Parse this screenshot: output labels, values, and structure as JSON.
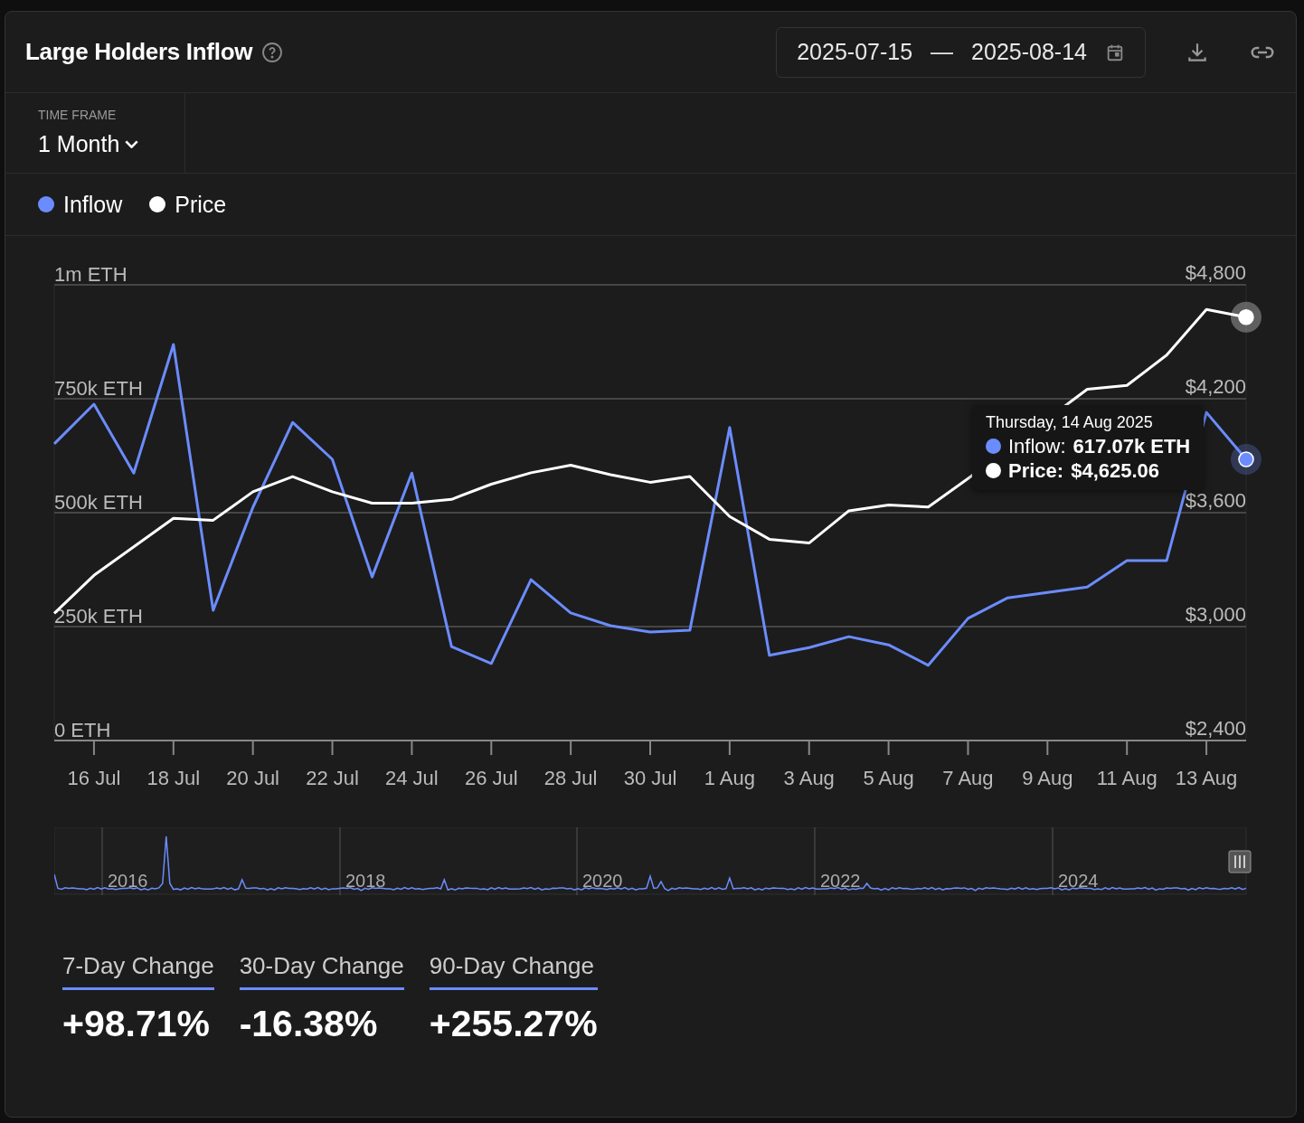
{
  "header": {
    "title": "Large Holders Inflow",
    "date_from": "2025-07-15",
    "date_separator": "—",
    "date_to": "2025-08-14"
  },
  "time_frame": {
    "label": "TIME FRAME",
    "value": "1 Month"
  },
  "chart": {
    "chart_data": {
      "type": "line",
      "categories": [
        null,
        "16 Jul",
        null,
        "18 Jul",
        null,
        "20 Jul",
        null,
        "22 Jul",
        null,
        "24 Jul",
        null,
        "26 Jul",
        null,
        "28 Jul",
        null,
        "30 Jul",
        null,
        "1 Aug",
        null,
        "3 Aug",
        null,
        "5 Aug",
        null,
        "7 Aug",
        null,
        "9 Aug",
        null,
        "11 Aug",
        null,
        "13 Aug",
        null
      ],
      "series": [
        {
          "name": "Inflow",
          "color": "#6b8cff",
          "values": [
            651000,
            738000,
            587000,
            869000,
            286000,
            512000,
            698000,
            617000,
            359000,
            587000,
            206000,
            169000,
            353000,
            280000,
            252000,
            238000,
            242000,
            687000,
            187000,
            204000,
            228000,
            210000,
            165000,
            268000,
            313000,
            null,
            337000,
            395000,
            395000,
            720000,
            617000
          ]
        },
        {
          "name": "Price",
          "color": "#ffffff",
          "axis": "y2",
          "values": [
            3070,
            3270,
            3420,
            3570,
            3560,
            3710,
            3790,
            3710,
            3650,
            3650,
            3670,
            3750,
            3810,
            3850,
            3800,
            3760,
            3790,
            3580,
            3460,
            3440,
            3610,
            3640,
            3630,
            3780,
            null,
            null,
            4250,
            4270,
            4430,
            4670,
            4630
          ]
        }
      ],
      "grid": true,
      "ylim": [
        0,
        1000000
      ],
      "y2lim": [
        2400,
        4800
      ],
      "yticks": [
        {
          "value": 0,
          "label": "0 ETH"
        },
        {
          "value": 250000,
          "label": "250k ETH"
        },
        {
          "value": 500000,
          "label": "500k ETH"
        },
        {
          "value": 750000,
          "label": "750k ETH"
        },
        {
          "value": 1000000,
          "label": "1m ETH"
        }
      ],
      "y2ticks": [
        {
          "value": 2400,
          "label": "$2,400"
        },
        {
          "value": 3000,
          "label": "$3,000"
        },
        {
          "value": 3600,
          "label": "$3,600"
        },
        {
          "value": 4200,
          "label": "$4,200"
        },
        {
          "value": 4800,
          "label": "$4,800"
        }
      ]
    },
    "tooltip": {
      "date": "Thursday, 14 Aug 2025",
      "rows": [
        {
          "label": "Inflow:",
          "value": "617.07k ETH",
          "color": "#6b8cff"
        },
        {
          "label": "Price:",
          "value": "$4,625.06",
          "color": "#ffffff"
        }
      ]
    }
  },
  "navigator": {
    "year_labels": [
      "2016",
      "2018",
      "2020",
      "2022",
      "2024"
    ]
  },
  "stats": [
    {
      "label": "7-Day Change",
      "value": "+98.71%"
    },
    {
      "label": "30-Day Change",
      "value": "-16.38%"
    },
    {
      "label": "90-Day Change",
      "value": "+255.27%"
    }
  ]
}
